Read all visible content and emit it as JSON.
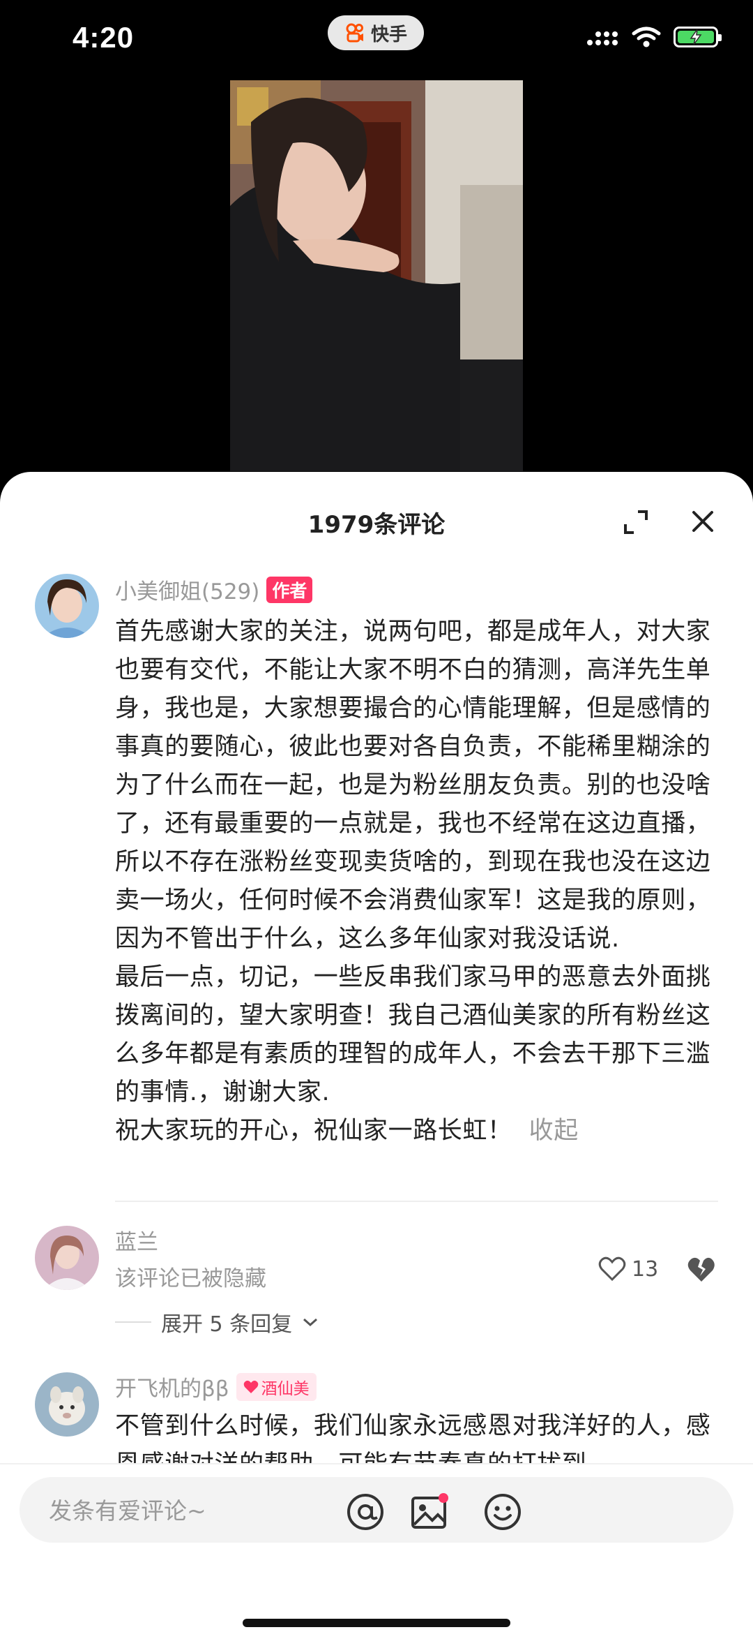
{
  "status_bar": {
    "time": "4:20",
    "app_name": "快手"
  },
  "sheet": {
    "title": "1979条评论"
  },
  "comments": [
    {
      "username": "小美御姐(529)",
      "badge": "作者",
      "text": "首先感谢大家的关注，说两句吧，都是成年人，对大家也要有交代，不能让大家不明不白的猜测，高洋先生单身，我也是，大家想要撮合的心情能理解，但是感情的事真的要随心，彼此也要对各自负责，不能稀里糊涂的为了什么而在一起，也是为粉丝朋友负责。别的也没啥了，还有最重要的一点就是，我也不经常在这边直播，所以不存在涨粉丝变现卖货啥的，到现在我也没在这边卖一场火，任何时候不会消费仙家军！这是我的原则，因为不管出于什么，这么多年仙家对我没话说.\n最后一点，切记，一些反串我们家马甲的恶意去外面挑拨离间的，望大家明查！我自己酒仙美家的所有粉丝这么多年都是有素质的理智的成年人，不会去干那下三滥的事情.，谢谢大家.\n祝大家玩的开心，祝仙家一路长虹！",
      "collapse_label": "收起"
    },
    {
      "username": "蓝兰",
      "hidden_text": "该评论已被隐藏",
      "likes": "13",
      "replies_label": "展开 5 条回复"
    },
    {
      "username": "开飞机的ββ",
      "fan_badge": "酒仙美",
      "text": "不管到什么时候，我们仙家永远感恩对我洋好的人，感恩感谢对洋的帮助，可能有节奏真的打扰到"
    }
  ],
  "input": {
    "placeholder": "发条有爱评论~"
  },
  "icons": [
    "kuaishou-logo-icon",
    "signal-icon",
    "wifi-icon",
    "battery-icon",
    "expand-icon",
    "close-icon",
    "heart-icon",
    "dislike-icon",
    "chevron-down-icon",
    "at-icon",
    "image-icon",
    "emoji-icon"
  ],
  "colors": {
    "accent": "#fe3666",
    "battery": "#4cd964",
    "muted_text": "#999999"
  }
}
